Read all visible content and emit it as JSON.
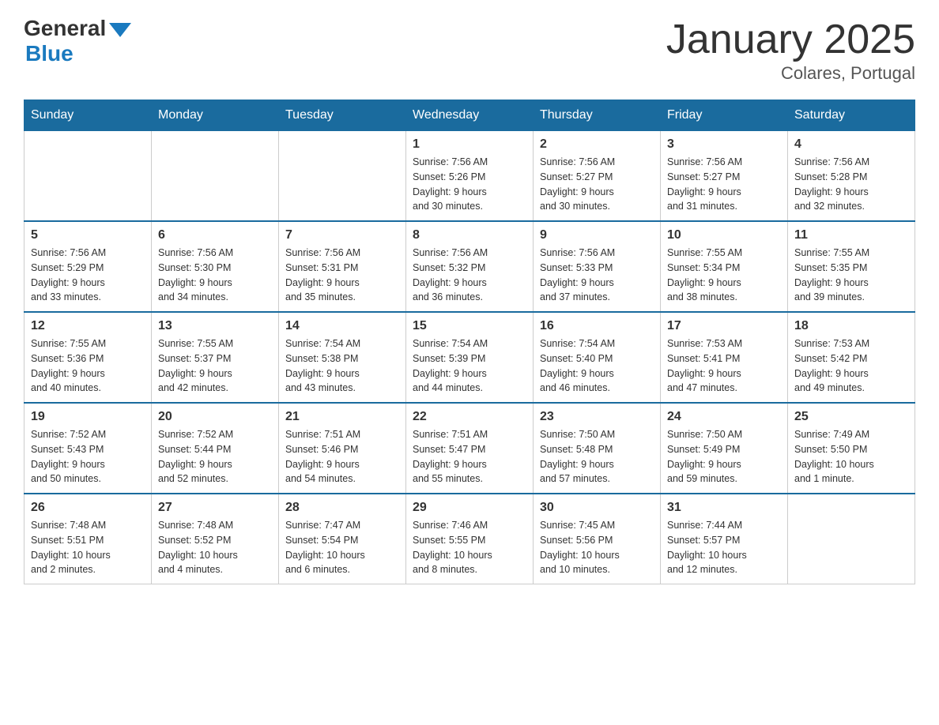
{
  "header": {
    "logo_general": "General",
    "logo_blue": "Blue",
    "title": "January 2025",
    "subtitle": "Colares, Portugal"
  },
  "days_of_week": [
    "Sunday",
    "Monday",
    "Tuesday",
    "Wednesday",
    "Thursday",
    "Friday",
    "Saturday"
  ],
  "weeks": [
    [
      {
        "day": "",
        "info": ""
      },
      {
        "day": "",
        "info": ""
      },
      {
        "day": "",
        "info": ""
      },
      {
        "day": "1",
        "info": "Sunrise: 7:56 AM\nSunset: 5:26 PM\nDaylight: 9 hours\nand 30 minutes."
      },
      {
        "day": "2",
        "info": "Sunrise: 7:56 AM\nSunset: 5:27 PM\nDaylight: 9 hours\nand 30 minutes."
      },
      {
        "day": "3",
        "info": "Sunrise: 7:56 AM\nSunset: 5:27 PM\nDaylight: 9 hours\nand 31 minutes."
      },
      {
        "day": "4",
        "info": "Sunrise: 7:56 AM\nSunset: 5:28 PM\nDaylight: 9 hours\nand 32 minutes."
      }
    ],
    [
      {
        "day": "5",
        "info": "Sunrise: 7:56 AM\nSunset: 5:29 PM\nDaylight: 9 hours\nand 33 minutes."
      },
      {
        "day": "6",
        "info": "Sunrise: 7:56 AM\nSunset: 5:30 PM\nDaylight: 9 hours\nand 34 minutes."
      },
      {
        "day": "7",
        "info": "Sunrise: 7:56 AM\nSunset: 5:31 PM\nDaylight: 9 hours\nand 35 minutes."
      },
      {
        "day": "8",
        "info": "Sunrise: 7:56 AM\nSunset: 5:32 PM\nDaylight: 9 hours\nand 36 minutes."
      },
      {
        "day": "9",
        "info": "Sunrise: 7:56 AM\nSunset: 5:33 PM\nDaylight: 9 hours\nand 37 minutes."
      },
      {
        "day": "10",
        "info": "Sunrise: 7:55 AM\nSunset: 5:34 PM\nDaylight: 9 hours\nand 38 minutes."
      },
      {
        "day": "11",
        "info": "Sunrise: 7:55 AM\nSunset: 5:35 PM\nDaylight: 9 hours\nand 39 minutes."
      }
    ],
    [
      {
        "day": "12",
        "info": "Sunrise: 7:55 AM\nSunset: 5:36 PM\nDaylight: 9 hours\nand 40 minutes."
      },
      {
        "day": "13",
        "info": "Sunrise: 7:55 AM\nSunset: 5:37 PM\nDaylight: 9 hours\nand 42 minutes."
      },
      {
        "day": "14",
        "info": "Sunrise: 7:54 AM\nSunset: 5:38 PM\nDaylight: 9 hours\nand 43 minutes."
      },
      {
        "day": "15",
        "info": "Sunrise: 7:54 AM\nSunset: 5:39 PM\nDaylight: 9 hours\nand 44 minutes."
      },
      {
        "day": "16",
        "info": "Sunrise: 7:54 AM\nSunset: 5:40 PM\nDaylight: 9 hours\nand 46 minutes."
      },
      {
        "day": "17",
        "info": "Sunrise: 7:53 AM\nSunset: 5:41 PM\nDaylight: 9 hours\nand 47 minutes."
      },
      {
        "day": "18",
        "info": "Sunrise: 7:53 AM\nSunset: 5:42 PM\nDaylight: 9 hours\nand 49 minutes."
      }
    ],
    [
      {
        "day": "19",
        "info": "Sunrise: 7:52 AM\nSunset: 5:43 PM\nDaylight: 9 hours\nand 50 minutes."
      },
      {
        "day": "20",
        "info": "Sunrise: 7:52 AM\nSunset: 5:44 PM\nDaylight: 9 hours\nand 52 minutes."
      },
      {
        "day": "21",
        "info": "Sunrise: 7:51 AM\nSunset: 5:46 PM\nDaylight: 9 hours\nand 54 minutes."
      },
      {
        "day": "22",
        "info": "Sunrise: 7:51 AM\nSunset: 5:47 PM\nDaylight: 9 hours\nand 55 minutes."
      },
      {
        "day": "23",
        "info": "Sunrise: 7:50 AM\nSunset: 5:48 PM\nDaylight: 9 hours\nand 57 minutes."
      },
      {
        "day": "24",
        "info": "Sunrise: 7:50 AM\nSunset: 5:49 PM\nDaylight: 9 hours\nand 59 minutes."
      },
      {
        "day": "25",
        "info": "Sunrise: 7:49 AM\nSunset: 5:50 PM\nDaylight: 10 hours\nand 1 minute."
      }
    ],
    [
      {
        "day": "26",
        "info": "Sunrise: 7:48 AM\nSunset: 5:51 PM\nDaylight: 10 hours\nand 2 minutes."
      },
      {
        "day": "27",
        "info": "Sunrise: 7:48 AM\nSunset: 5:52 PM\nDaylight: 10 hours\nand 4 minutes."
      },
      {
        "day": "28",
        "info": "Sunrise: 7:47 AM\nSunset: 5:54 PM\nDaylight: 10 hours\nand 6 minutes."
      },
      {
        "day": "29",
        "info": "Sunrise: 7:46 AM\nSunset: 5:55 PM\nDaylight: 10 hours\nand 8 minutes."
      },
      {
        "day": "30",
        "info": "Sunrise: 7:45 AM\nSunset: 5:56 PM\nDaylight: 10 hours\nand 10 minutes."
      },
      {
        "day": "31",
        "info": "Sunrise: 7:44 AM\nSunset: 5:57 PM\nDaylight: 10 hours\nand 12 minutes."
      },
      {
        "day": "",
        "info": ""
      }
    ]
  ]
}
